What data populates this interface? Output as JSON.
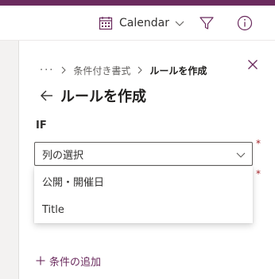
{
  "command_bar": {
    "view_label": "Calendar",
    "view_icon": "calendar-icon",
    "filter_icon": "filter-icon",
    "info_icon": "info-icon"
  },
  "panel": {
    "breadcrumb": {
      "more": "···",
      "items": [
        "条件付き書式"
      ],
      "current": "ルールを作成"
    },
    "title": "ルールを作成",
    "if_label": "IF",
    "column_select": {
      "placeholder": "列の選択",
      "required_mark": "*"
    },
    "second_required_mark": "*",
    "dropdown_options": [
      "公開・開催日",
      "Title"
    ],
    "add_condition": "条件の追加"
  },
  "colors": {
    "accent": "#6b2b5e",
    "text": "#323130",
    "required": "#a4262c"
  }
}
